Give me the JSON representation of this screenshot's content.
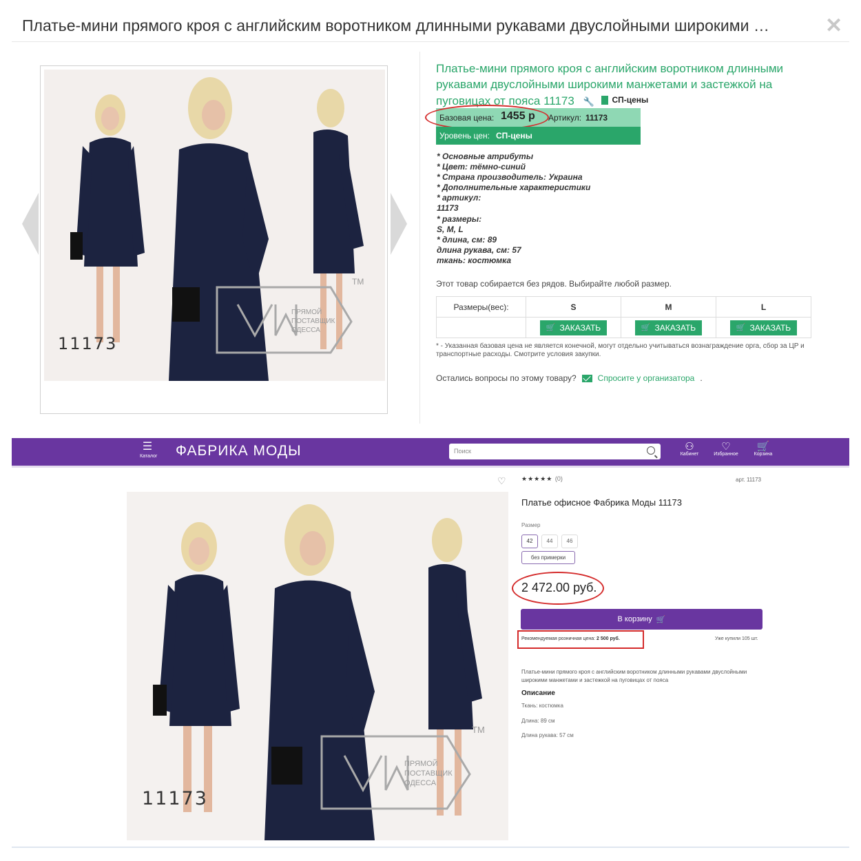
{
  "modal": {
    "title": "Платье-мини прямого кроя с английским воротником длинными рукавами двуслойными широкими …",
    "close_glyph": "✕"
  },
  "product_sp": {
    "title": "Платье-мини прямого кроя с английским воротником длинными рукавами двуслойными широкими манжетами и застежкой на пуговицах от пояса 11173",
    "wrench_glyph": "🔧",
    "sp_badge": "СП-цены",
    "base_price_label": "Базовая цена:",
    "base_price_value": "1455 р",
    "article_label": "Артикул:",
    "article_value": "11173",
    "price_level_label": "Уровень цен:",
    "price_level_value": "СП-цены",
    "attributes": [
      "* Основные атрибуты",
      "* Цвет: тёмно-синий",
      "* Страна производитель: Украина",
      "* Дополнительные характеристики",
      "* артикул:",
      "11173",
      "* размеры:",
      "S, M, L",
      "* длина, см: 89",
      "длина рукава, см: 57",
      "ткань: костюмка"
    ],
    "no_rows_note": "Этот товар собирается без рядов. Выбирайте любой размер.",
    "sizes_header": "Размеры(вес):",
    "sizes": [
      "S",
      "M",
      "L"
    ],
    "order_label": "ЗАКАЗАТЬ",
    "footnote": "* - Указанная базовая цена не является конечной, могут отдельно учитываться вознаграждение орга, сбор за ЦР и транспортные расходы. Смотрите условия закупки.",
    "questions_text": "Остались вопросы по этому товару?",
    "ask_link": "Спросите у организатора",
    "photo_number": "11173",
    "watermark": [
      "ПРЯМОЙ",
      "ПОСТАВЩИК",
      "ОДЕССА"
    ],
    "tm": "TM"
  },
  "site": {
    "catalog_label": "Каталог",
    "logo_text": "ФАБРИКА МОДЫ",
    "search_placeholder": "Поиск",
    "nav": [
      {
        "label": "Кабинет",
        "glyph": "⚇"
      },
      {
        "label": "Избранное",
        "glyph": "♡"
      },
      {
        "label": "Корзина",
        "glyph": "🛒"
      }
    ],
    "rating_stars": "★★★★★",
    "rating_count": "(0)",
    "article": "арт. 11173",
    "title": "Платье офисное Фабрика Моды 11173",
    "size_label": "Размер",
    "size_chips": [
      "42",
      "44",
      "46"
    ],
    "fit_chip": "без примерки",
    "price": "2 472.00 руб.",
    "cart_button": "В корзину",
    "rrp_label": "Рекомендуемая розничная цена:",
    "rrp_value": "2 500 руб.",
    "bought": "Уже купили 105 шт.",
    "short_description": "Платье-мини прямого кроя с английским воротником длинными рукавами двуслойными широкими манжетами и застежкой на пуговицах от пояса",
    "description_heading": "Описание",
    "description_lines": [
      "Ткань: костюмка",
      "Длина: 89 см",
      "Длина рукава: 57 см"
    ],
    "photo_number": "11173",
    "tm": "TM"
  },
  "colors": {
    "green": "#2aa66a",
    "light_green": "#8fd8b4",
    "purple": "#6936a0",
    "annotation_red": "#d42a2a",
    "dress_navy": "#1c2340"
  }
}
